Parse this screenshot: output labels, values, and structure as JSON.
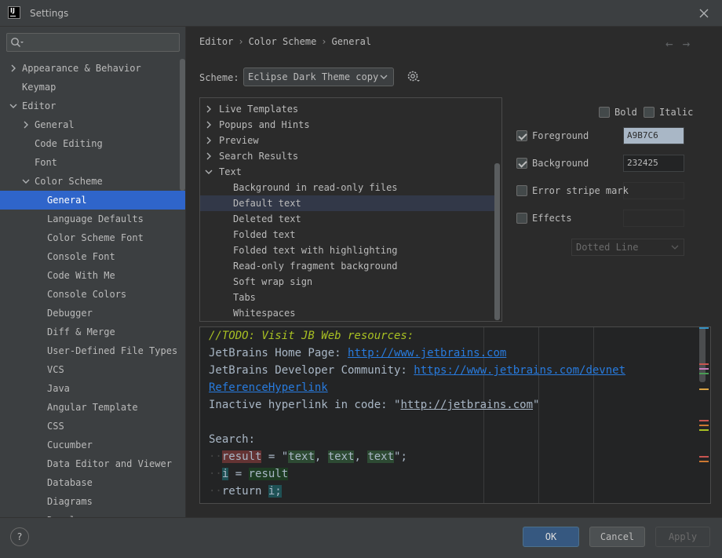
{
  "window": {
    "title": "Settings"
  },
  "sidebar": {
    "search_value": "",
    "items": [
      {
        "label": "Appearance & Behavior",
        "indent": 0,
        "arrow": "right"
      },
      {
        "label": "Keymap",
        "indent": 0,
        "arrow": "none"
      },
      {
        "label": "Editor",
        "indent": 0,
        "arrow": "down"
      },
      {
        "label": "General",
        "indent": 1,
        "arrow": "right"
      },
      {
        "label": "Code Editing",
        "indent": 1,
        "arrow": "none"
      },
      {
        "label": "Font",
        "indent": 1,
        "arrow": "none"
      },
      {
        "label": "Color Scheme",
        "indent": 1,
        "arrow": "down"
      },
      {
        "label": "General",
        "indent": 2,
        "arrow": "none",
        "selected": true
      },
      {
        "label": "Language Defaults",
        "indent": 2,
        "arrow": "none"
      },
      {
        "label": "Color Scheme Font",
        "indent": 2,
        "arrow": "none"
      },
      {
        "label": "Console Font",
        "indent": 2,
        "arrow": "none"
      },
      {
        "label": "Code With Me",
        "indent": 2,
        "arrow": "none"
      },
      {
        "label": "Console Colors",
        "indent": 2,
        "arrow": "none"
      },
      {
        "label": "Debugger",
        "indent": 2,
        "arrow": "none"
      },
      {
        "label": "Diff & Merge",
        "indent": 2,
        "arrow": "none"
      },
      {
        "label": "User-Defined File Types",
        "indent": 2,
        "arrow": "none"
      },
      {
        "label": "VCS",
        "indent": 2,
        "arrow": "none"
      },
      {
        "label": "Java",
        "indent": 2,
        "arrow": "none"
      },
      {
        "label": "Angular Template",
        "indent": 2,
        "arrow": "none"
      },
      {
        "label": "CSS",
        "indent": 2,
        "arrow": "none"
      },
      {
        "label": "Cucumber",
        "indent": 2,
        "arrow": "none"
      },
      {
        "label": "Data Editor and Viewer",
        "indent": 2,
        "arrow": "none"
      },
      {
        "label": "Database",
        "indent": 2,
        "arrow": "none"
      },
      {
        "label": "Diagrams",
        "indent": 2,
        "arrow": "none"
      },
      {
        "label": "Drools",
        "indent": 2,
        "arrow": "none"
      }
    ]
  },
  "breadcrumb": {
    "part1": "Editor",
    "part2": "Color Scheme",
    "part3": "General",
    "sep": "›"
  },
  "nav": {
    "back": "←",
    "forward": "→"
  },
  "scheme": {
    "label": "Scheme:",
    "value": "Eclipse Dark Theme copy"
  },
  "attributes": {
    "items": [
      {
        "label": "Live Templates",
        "indent": 0,
        "arrow": "right"
      },
      {
        "label": "Popups and Hints",
        "indent": 0,
        "arrow": "right"
      },
      {
        "label": "Preview",
        "indent": 0,
        "arrow": "right"
      },
      {
        "label": "Search Results",
        "indent": 0,
        "arrow": "right"
      },
      {
        "label": "Text",
        "indent": 0,
        "arrow": "down"
      },
      {
        "label": "Background in read-only files",
        "indent": 1,
        "arrow": "none"
      },
      {
        "label": "Default text",
        "indent": 1,
        "arrow": "none",
        "selected": true
      },
      {
        "label": "Deleted text",
        "indent": 1,
        "arrow": "none"
      },
      {
        "label": "Folded text",
        "indent": 1,
        "arrow": "none"
      },
      {
        "label": "Folded text with highlighting",
        "indent": 1,
        "arrow": "none"
      },
      {
        "label": "Read-only fragment background",
        "indent": 1,
        "arrow": "none"
      },
      {
        "label": "Soft wrap sign",
        "indent": 1,
        "arrow": "none"
      },
      {
        "label": "Tabs",
        "indent": 1,
        "arrow": "none"
      },
      {
        "label": "Whitespaces",
        "indent": 1,
        "arrow": "none"
      }
    ]
  },
  "options": {
    "bold": "Bold",
    "italic": "Italic",
    "foreground": {
      "label": "Foreground",
      "checked": true,
      "value": "A9B7C6",
      "color": "#a9b7c6"
    },
    "background": {
      "label": "Background",
      "checked": true,
      "value": "232425",
      "color": "#232425"
    },
    "error_stripe": {
      "label": "Error stripe mark",
      "checked": false
    },
    "effects": {
      "label": "Effects",
      "checked": false
    },
    "effect_type": "Dotted Line"
  },
  "preview": {
    "todo": "//TODO: Visit JB Web resources:",
    "home_label": "JetBrains Home Page: ",
    "home_url": "http://www.jetbrains.com",
    "dev_label": "JetBrains Developer Community: ",
    "dev_url": "https://www.jetbrains.com/devnet",
    "ref_link": "ReferenceHyperlink",
    "inactive_label": "Inactive hyperlink in code: \"",
    "inactive_url": "http://jetbrains.com",
    "inactive_end": "\"",
    "search": "Search:",
    "l1_dots": "··",
    "l1_var": "result",
    "l1_eq": " = \"",
    "l1_t1": "text",
    "l1_comma1": ", ",
    "l1_t2": "text",
    "l1_comma2": ", ",
    "l1_t3": "text",
    "l1_end": "\";",
    "l2_dots": "··",
    "l2_var": "i",
    "l2_eq": " = ",
    "l2_res": "result",
    "l3_dots": "··",
    "l3_ret": "return ",
    "l3_var": "i;"
  },
  "footer": {
    "help": "?",
    "ok": "OK",
    "cancel": "Cancel",
    "apply": "Apply"
  }
}
